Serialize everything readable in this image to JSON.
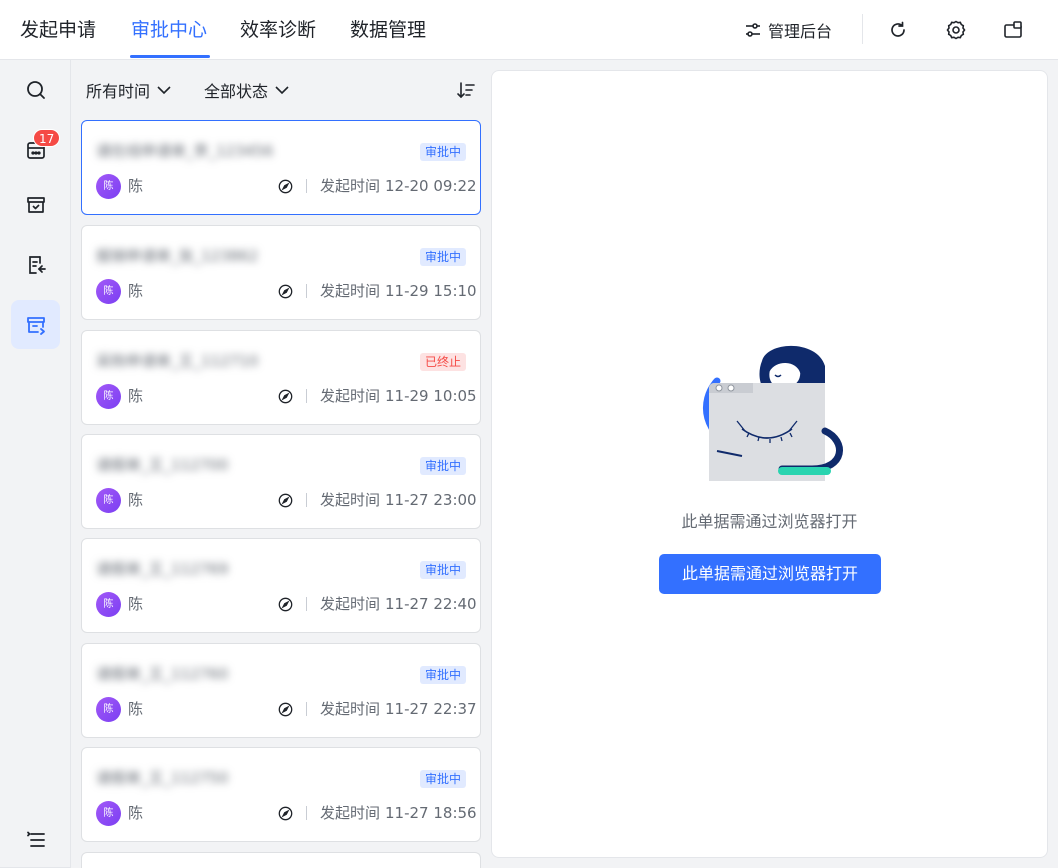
{
  "topbar": {
    "tabs": [
      {
        "label": "发起申请"
      },
      {
        "label": "审批中心"
      },
      {
        "label": "效率诊断"
      },
      {
        "label": "数据管理"
      }
    ],
    "admin_label": "管理后台"
  },
  "rail": {
    "badge_count": "17"
  },
  "filters": {
    "time_label": "所有时间",
    "status_label": "全部状态"
  },
  "cards": [
    {
      "title": "请在线申请单_李_123456",
      "status": "审批中",
      "avatar_text": "陈",
      "name": "陈",
      "time_label": "发起时间",
      "time": "12-20 09:22"
    },
    {
      "title": "报销申请单_张_123862",
      "status": "审批中",
      "avatar_text": "陈",
      "name": "陈",
      "time_label": "发起时间",
      "time": "11-29 15:10"
    },
    {
      "title": "采购申请单_王_112710",
      "status": "已终止",
      "avatar_text": "陈",
      "name": "陈",
      "time_label": "发起时间",
      "time": "11-29 10:05"
    },
    {
      "title": "请假单_王_112700",
      "status": "审批中",
      "avatar_text": "陈",
      "name": "陈",
      "time_label": "发起时间",
      "time": "11-27 23:00"
    },
    {
      "title": "请假单_王_112769",
      "status": "审批中",
      "avatar_text": "陈",
      "name": "陈",
      "time_label": "发起时间",
      "time": "11-27 22:40"
    },
    {
      "title": "请假单_王_112760",
      "status": "审批中",
      "avatar_text": "陈",
      "name": "陈",
      "time_label": "发起时间",
      "time": "11-27 22:37"
    },
    {
      "title": "请假单_王_112750",
      "status": "审批中",
      "avatar_text": "陈",
      "name": "陈",
      "time_label": "发起时间",
      "time": "11-27 18:56"
    }
  ],
  "panel": {
    "message": "此单据需通过浏览器打开",
    "button_label": "此单据需通过浏览器打开"
  },
  "colors": {
    "accent": "#3370ff",
    "danger": "#f54a45",
    "avatar": "#8b4bf5"
  }
}
